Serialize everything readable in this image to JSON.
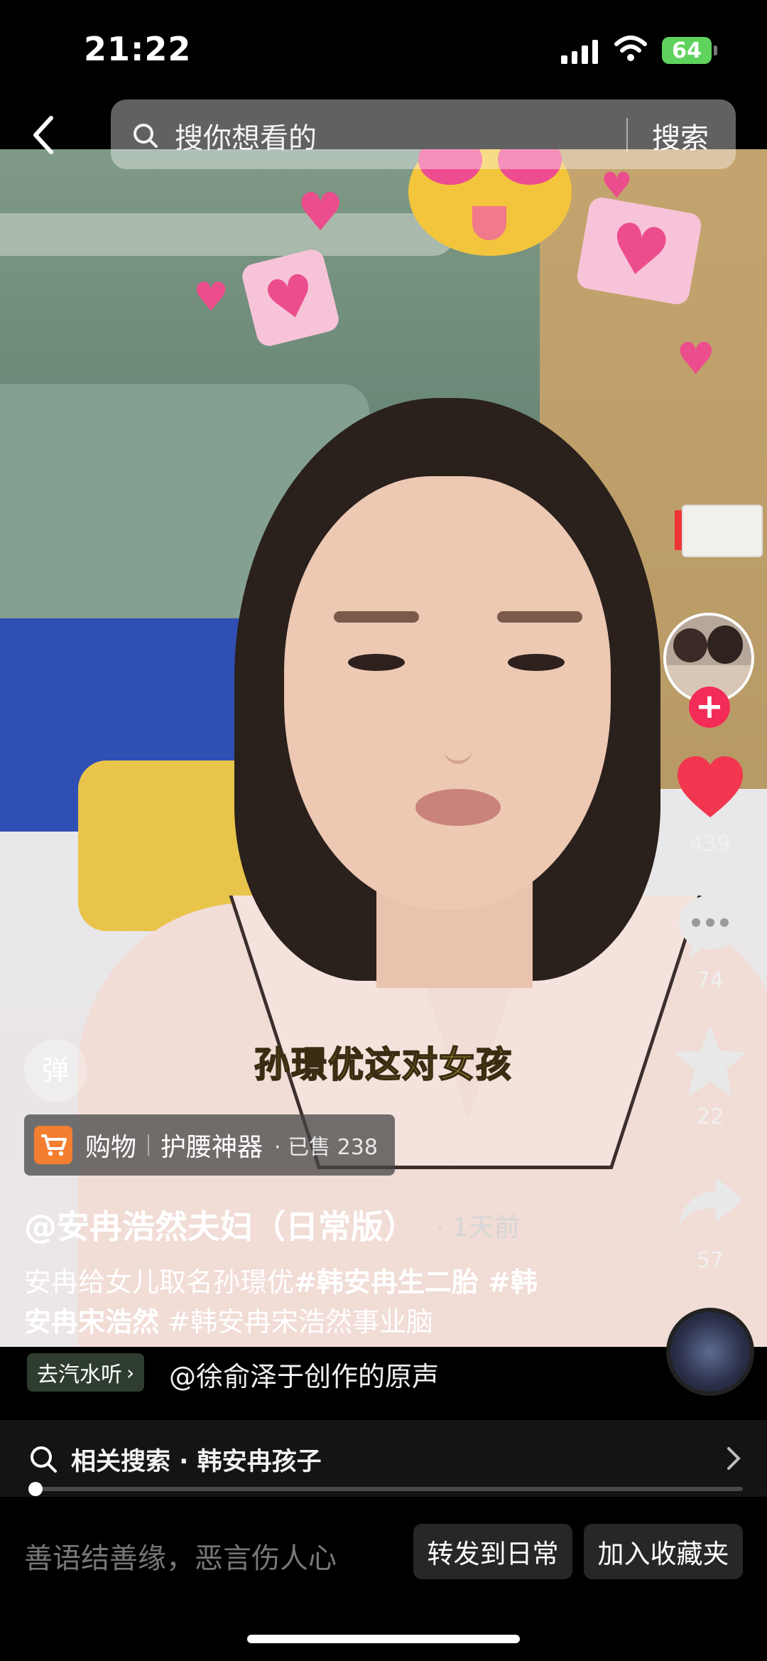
{
  "status_bar": {
    "time": "21:22",
    "battery": "64"
  },
  "search": {
    "placeholder": "搜你想看的",
    "button": "搜索"
  },
  "video": {
    "caption": "孙璟优这对女孩"
  },
  "rail": {
    "likes": "439",
    "comments": "74",
    "favorites": "22",
    "shares": "57"
  },
  "overlay": {
    "danmu_label": "弹",
    "shop": {
      "tag": "购物",
      "product": "护腰神器",
      "sold": "· 已售 238"
    },
    "author": "@安冉浩然夫妇（日常版）",
    "time_ago": "· 1天前",
    "description": {
      "plain": "安冉给女儿取名孙璟优",
      "hashtag1": "#韩安冉生二胎 #韩",
      "hashtag2": "安冉宋浩然",
      "hashtag3": "#韩安冉宋浩然事业脑"
    }
  },
  "music": {
    "tag": "去汽水听",
    "text": "@徐俞泽于创作的原声"
  },
  "related": {
    "label": "相关搜索 · 韩安冉孩子"
  },
  "playback": {
    "progress": 0.01
  },
  "bottom": {
    "comment_placeholder": "善语结善缘，恶言伤人心",
    "forward_button": "转发到日常",
    "favorite_button": "加入收藏夹"
  },
  "colors": {
    "like_red": "#f2364f",
    "follow_red": "#f22c56",
    "cart_orange": "#f47e2f",
    "battery_green": "#5fd35d"
  }
}
